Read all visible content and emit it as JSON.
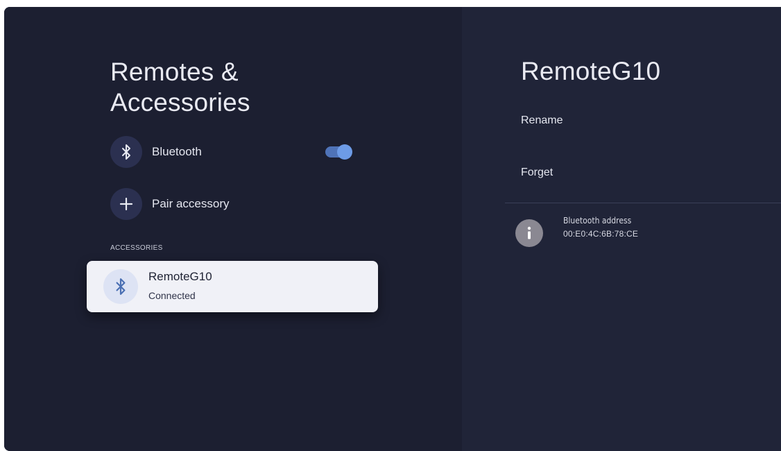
{
  "left_panel": {
    "title": "Remotes & Accessories",
    "items": [
      {
        "label": "Bluetooth",
        "icon": "bluetooth-icon",
        "toggle_on": true
      },
      {
        "label": "Pair accessory",
        "icon": "plus-icon"
      }
    ],
    "section_header": "ACCESSORIES",
    "accessories": [
      {
        "name": "RemoteG10",
        "status": "Connected",
        "icon": "bluetooth-icon"
      }
    ]
  },
  "right_panel": {
    "title": "RemoteG10",
    "menu": [
      {
        "label": "Rename"
      },
      {
        "label": "Forget"
      }
    ],
    "info": {
      "icon": "info-icon",
      "label": "Bluetooth address",
      "value": "00:E0:4C:6B:78:CE"
    }
  },
  "colors": {
    "background_left": "#1c1f31",
    "background_right": "#202438",
    "accent": "#6d9be6",
    "card": "#f0f1f7"
  }
}
